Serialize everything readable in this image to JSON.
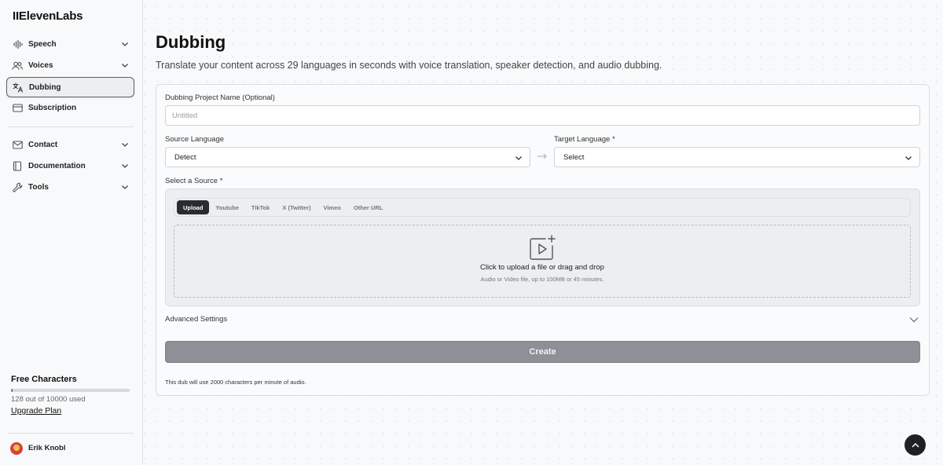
{
  "app": {
    "logo": "IIElevenLabs"
  },
  "sidebar": {
    "items": [
      {
        "label": "Speech",
        "icon": "waveform-icon",
        "has_chevron": true
      },
      {
        "label": "Voices",
        "icon": "people-icon",
        "has_chevron": true
      },
      {
        "label": "Dubbing",
        "icon": "translate-icon",
        "has_chevron": false,
        "active": true
      },
      {
        "label": "Subscription",
        "icon": "card-icon",
        "has_chevron": false
      }
    ],
    "secondary_items": [
      {
        "label": "Contact",
        "icon": "mail-icon",
        "has_chevron": true
      },
      {
        "label": "Documentation",
        "icon": "book-icon",
        "has_chevron": true
      },
      {
        "label": "Tools",
        "icon": "wrench-icon",
        "has_chevron": true
      }
    ],
    "usage": {
      "title": "Free Characters",
      "text": "128 out of 10000 used",
      "fraction_used": 0.0128,
      "upgrade_label": "Upgrade Plan"
    },
    "user": {
      "name": "Erik Knobl"
    }
  },
  "main": {
    "title": "Dubbing",
    "subtitle": "Translate your content across 29 languages in seconds with voice translation, speaker detection, and audio dubbing.",
    "form": {
      "project_name_label": "Dubbing Project Name (Optional)",
      "project_name_placeholder": "Untitled",
      "project_name_value": "",
      "source_language_label": "Source Language",
      "source_language_value": "Detect",
      "target_language_label": "Target Language *",
      "target_language_value": "Select",
      "source_label": "Select a Source *",
      "tabs": [
        "Upload",
        "Youtube",
        "TikTok",
        "X (Twitter)",
        "Vimeo",
        "Other URL"
      ],
      "active_tab": "Upload",
      "dropzone_text": "Click to upload a file or drag and drop",
      "dropzone_subtext": "Audio or Video file, up to 100MB or 45 minutes.",
      "advanced_label": "Advanced Settings",
      "create_label": "Create",
      "footnote": "This dub will use 2000 characters per minute of audio."
    }
  },
  "colors": {
    "active_tab_bg": "#2a2b30",
    "create_button_bg": "#8e9097",
    "scroll_top_bg": "#1f2024"
  }
}
